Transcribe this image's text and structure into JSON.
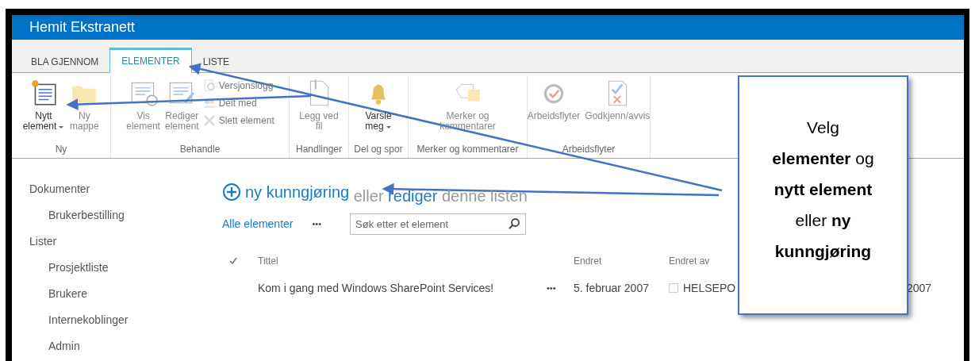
{
  "header": {
    "title": "Hemit Ekstranett"
  },
  "tabs": [
    {
      "label": "BLA GJENNOM",
      "selected": false
    },
    {
      "label": "ELEMENTER",
      "selected": true
    },
    {
      "label": "LISTE",
      "selected": false
    }
  ],
  "ribbon": {
    "groups": [
      {
        "label": "Ny",
        "buttons": [
          {
            "kind": "large",
            "lines": [
              "Nytt",
              "element"
            ],
            "disabled": false,
            "dropdown": true
          },
          {
            "kind": "large",
            "lines": [
              "Ny",
              "mappe"
            ],
            "disabled": true
          }
        ]
      },
      {
        "label": "Behandle",
        "buttons": [
          {
            "kind": "large",
            "lines": [
              "Vis",
              "element"
            ],
            "disabled": true
          },
          {
            "kind": "large",
            "lines": [
              "Rediger",
              "element"
            ],
            "disabled": true
          },
          {
            "kind": "small",
            "lines": [
              "Versjonslogg"
            ],
            "disabled": true
          },
          {
            "kind": "small",
            "lines": [
              "Delt med"
            ],
            "disabled": true
          },
          {
            "kind": "small",
            "lines": [
              "Slett element"
            ],
            "disabled": true
          }
        ]
      },
      {
        "label": "Handlinger",
        "buttons": [
          {
            "kind": "large",
            "lines": [
              "Legg ved",
              "fil"
            ],
            "disabled": true
          }
        ]
      },
      {
        "label": "Del og spor",
        "buttons": [
          {
            "kind": "large",
            "lines": [
              "Varsle",
              "meg"
            ],
            "disabled": false,
            "dropdown": true
          }
        ]
      },
      {
        "label": "Merker og kommentarer",
        "buttons": [
          {
            "kind": "large",
            "lines": [
              "Merker og",
              "kommentarer"
            ],
            "disabled": true
          }
        ]
      },
      {
        "label": "Arbeidsflyter",
        "buttons": [
          {
            "kind": "large",
            "lines": [
              "Arbeidsflyter"
            ],
            "disabled": true
          },
          {
            "kind": "large",
            "lines": [
              "Godkjenn/avvis"
            ],
            "disabled": true
          }
        ]
      }
    ]
  },
  "sidebar": {
    "items": [
      {
        "label": "Dokumenter",
        "children": [
          {
            "label": "Brukerbestilling"
          }
        ]
      },
      {
        "label": "Lister",
        "children": [
          {
            "label": "Prosjektliste"
          },
          {
            "label": "Brukere"
          },
          {
            "label": "Internekoblinger"
          },
          {
            "label": "Admin"
          }
        ]
      }
    ]
  },
  "heading": {
    "new_link": "ny kunngjøring",
    "text_1": "eller",
    "edit_link": "rediger",
    "text_2": "denne listen"
  },
  "view": {
    "label": "Alle elementer",
    "more": "•••"
  },
  "search": {
    "placeholder": "Søk etter et element"
  },
  "table": {
    "columns": [
      "Tittel",
      "Endret",
      "Endret av"
    ],
    "rows": [
      {
        "title": "Kom i gang med Windows SharePoint Services!",
        "more": "•••",
        "modified": "5. februar 2007",
        "modified_by": "HELSEPO",
        "column_5": "2007"
      }
    ]
  },
  "callout": {
    "text": "Velg **elementer** og **nytt element** eller **ny kunngjøring**"
  }
}
